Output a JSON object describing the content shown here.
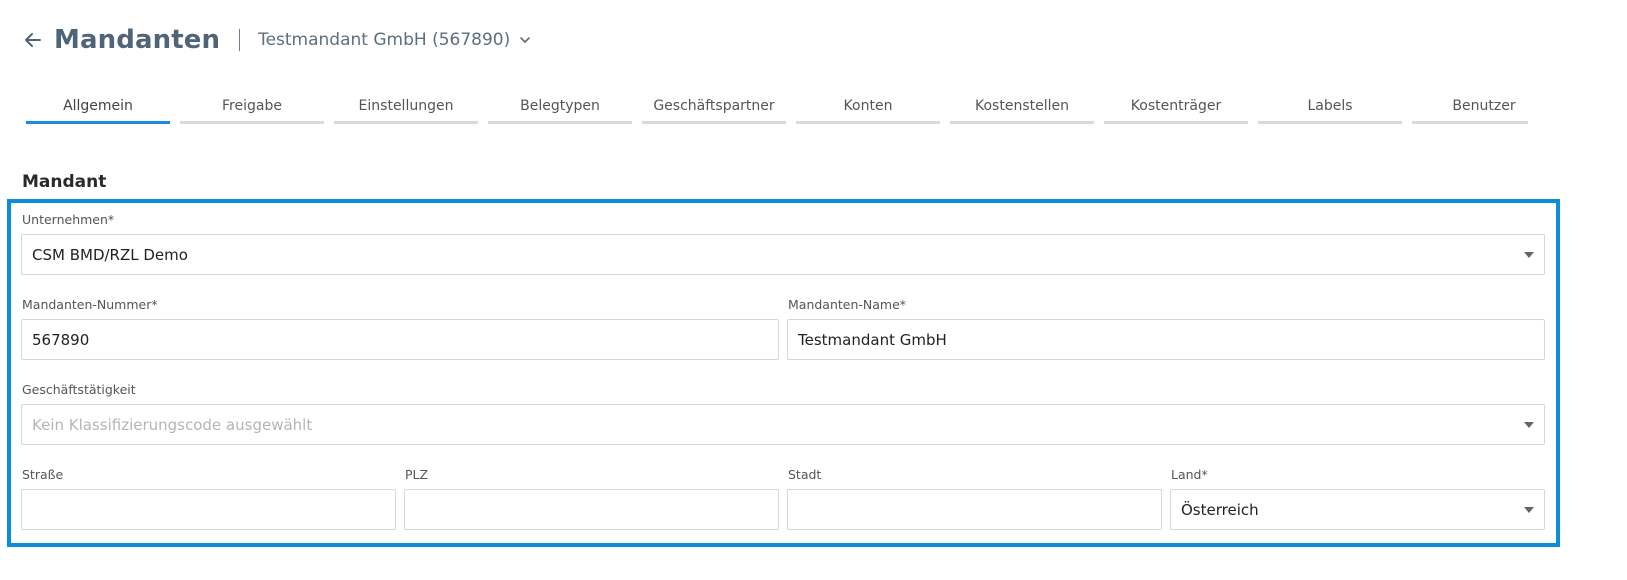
{
  "header": {
    "title": "Mandanten",
    "client": "Testmandant GmbH (567890)"
  },
  "tabs": [
    {
      "label": "Allgemein",
      "active": true
    },
    {
      "label": "Freigabe"
    },
    {
      "label": "Einstellungen"
    },
    {
      "label": "Belegtypen"
    },
    {
      "label": "Geschäftspartner"
    },
    {
      "label": "Konten"
    },
    {
      "label": "Kostenstellen"
    },
    {
      "label": "Kostenträger"
    },
    {
      "label": "Labels"
    },
    {
      "label": "Benutzer"
    }
  ],
  "section": {
    "title": "Mandant"
  },
  "form": {
    "unternehmen": {
      "label": "Unternehmen*",
      "value": "CSM BMD/RZL Demo"
    },
    "nummer": {
      "label": "Mandanten-Nummer*",
      "value": "567890"
    },
    "name": {
      "label": "Mandanten-Name*",
      "value": "Testmandant GmbH"
    },
    "taetigkeit": {
      "label": "Geschäftstätigkeit",
      "placeholder": "Kein Klassifizierungscode ausgewählt"
    },
    "strasse": {
      "label": "Straße",
      "value": ""
    },
    "plz": {
      "label": "PLZ",
      "value": ""
    },
    "stadt": {
      "label": "Stadt",
      "value": ""
    },
    "land": {
      "label": "Land*",
      "value": "Österreich"
    }
  },
  "colors": {
    "accent": "#0a8fd6",
    "tab_active": "#1e88e5",
    "title": "#4f6577"
  },
  "icons": {
    "back": "arrow-left-icon",
    "client_dropdown": "chevron-down-icon",
    "select": "caret-down-icon"
  }
}
